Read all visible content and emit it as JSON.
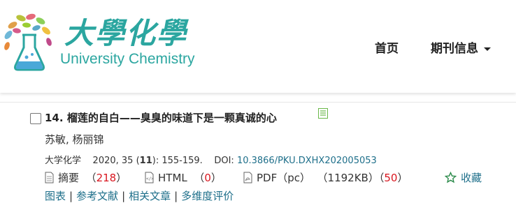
{
  "header": {
    "logo_cn": "大學化學",
    "logo_en": "University Chemistry",
    "nav": {
      "home": "首页",
      "journal_info": "期刊信息"
    }
  },
  "article": {
    "number": "14.",
    "title": "榴莲的自白——臭臭的味道下是一颗真诚的心",
    "authors": "苏敏, 杨丽锦",
    "journal": "大学化学",
    "year_volume": "2020, 35 (",
    "issue": "11",
    "pages": "): 155-159.",
    "doi_label": "DOI:",
    "doi": "10.3866/PKU.DXHX202005053",
    "metrics": {
      "abstract_label": "摘要",
      "abstract_count_open": "（",
      "abstract_count": "218",
      "abstract_count_close": "）",
      "html_label": "HTML",
      "html_count_open": "（",
      "html_count": "0",
      "html_count_close": "）",
      "pdf_label": "PDF（pc）",
      "pdf_size": "（1192KB）",
      "pdf_count_open": "（",
      "pdf_count": "50",
      "pdf_count_close": "）",
      "favorite_label": "收藏"
    },
    "links": [
      "图表",
      "参考文献",
      "相关文章",
      "多维度评价"
    ],
    "link_separator": "|"
  },
  "colors": {
    "brand_teal": "#2ba6a0",
    "link": "#1e6f8a",
    "count_red": "#d9161f"
  },
  "icons": [
    "logo-flask-tree-icon",
    "document-icon",
    "abstract-icon",
    "html-icon",
    "pdf-icon",
    "star-icon",
    "caret-down-icon"
  ]
}
